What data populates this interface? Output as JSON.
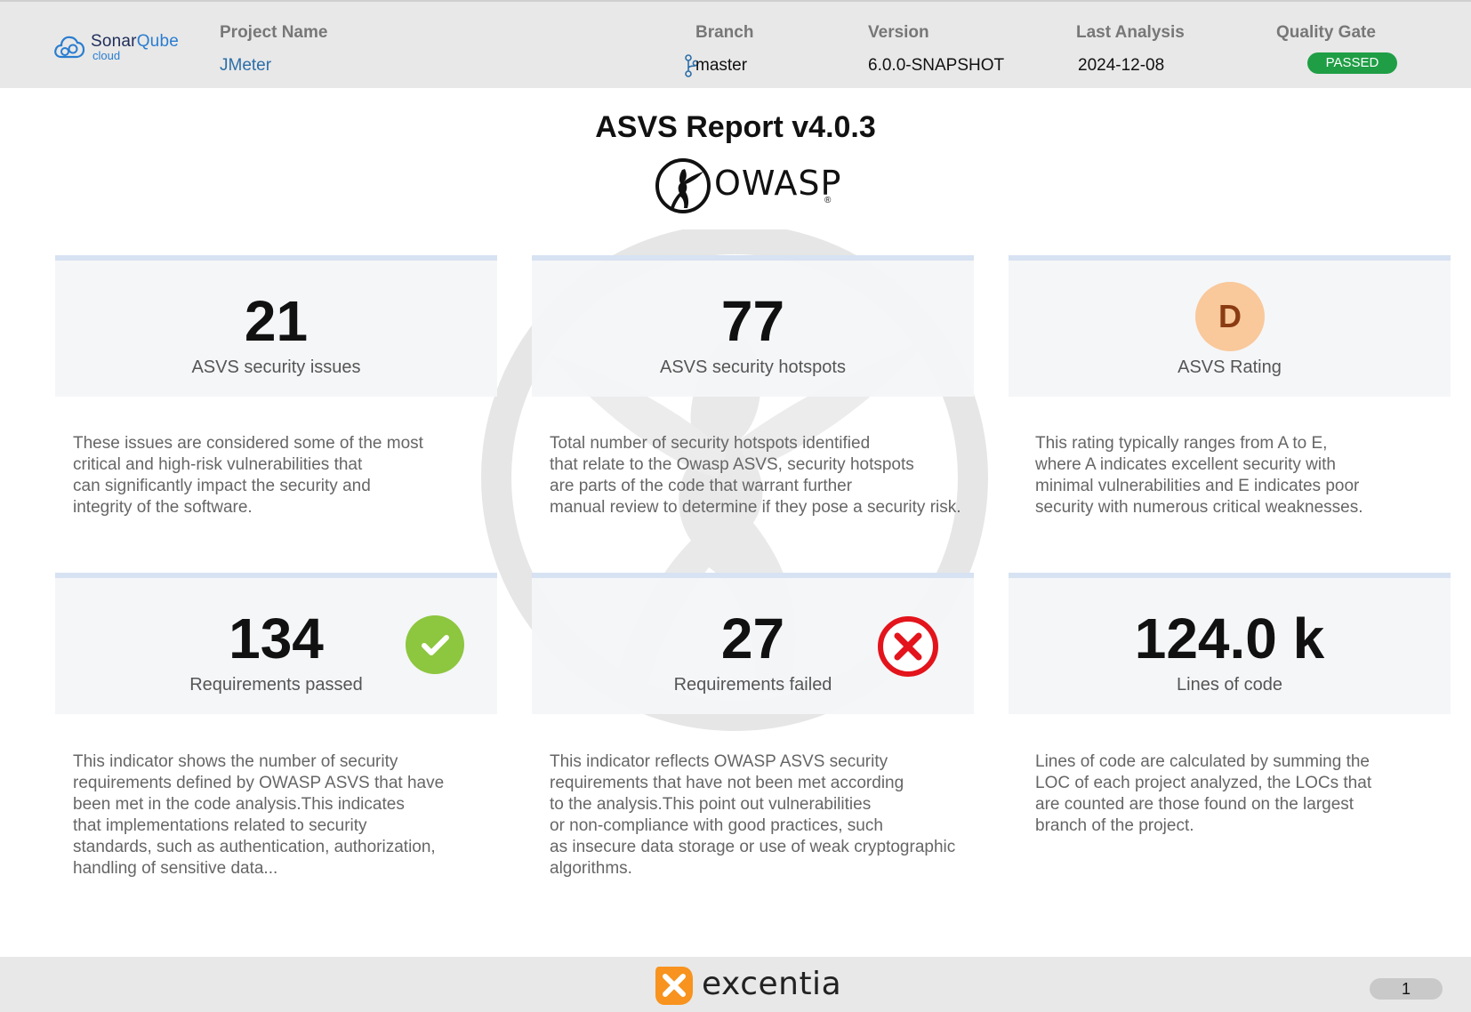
{
  "header": {
    "brand_name_a": "Sonar",
    "brand_name_b": "Qube",
    "brand_sub": "cloud",
    "project_label": "Project Name",
    "project_value": "JMeter",
    "branch_label": "Branch",
    "branch_value": "master",
    "version_label": "Version",
    "version_value": "6.0.0-SNAPSHOT",
    "analysis_label": "Last Analysis",
    "analysis_value": "2024-12-08",
    "gate_label": "Quality Gate",
    "gate_value": "PASSED"
  },
  "title": "ASVS Report v4.0.3",
  "owasp": {
    "text": "OWASP",
    "reg": "®"
  },
  "cards": {
    "issues": {
      "value": "21",
      "caption": "ASVS security issues"
    },
    "hotspots": {
      "value": "77",
      "caption": "ASVS security hotspots"
    },
    "rating": {
      "value": "D",
      "caption": "ASVS Rating"
    },
    "passed": {
      "value": "134",
      "caption": "Requirements passed"
    },
    "failed": {
      "value": "27",
      "caption": "Requirements failed"
    },
    "loc": {
      "value": "124.0 k",
      "caption": "Lines of code"
    }
  },
  "descriptions": {
    "issues": [
      "These issues are considered some of the most",
      "critical and high-risk vulnerabilities that",
      "can significantly impact the security and",
      "integrity of the software."
    ],
    "hotspots": [
      "Total number of security hotspots identified",
      "that relate to the Owasp ASVS, security hotspots",
      "are parts of the code that warrant further",
      "manual review to determine if they pose a security risk."
    ],
    "rating": [
      "This rating typically ranges from A to E,",
      "where A indicates excellent security with",
      "minimal vulnerabilities and E indicates poor",
      "security with numerous critical weaknesses."
    ],
    "passed": [
      "This indicator shows the number of security",
      "requirements defined by OWASP ASVS that have",
      "been met in the code analysis.This indicates",
      "that implementations related to security",
      "standards, such as authentication, authorization,",
      "handling of sensitive data..."
    ],
    "failed": [
      "This indicator reflects OWASP ASVS security",
      "requirements that have not been met according",
      "to the analysis.This point out vulnerabilities",
      "or non-compliance with good practices, such",
      "as insecure data storage or use of weak cryptographic",
      "algorithms."
    ],
    "loc": [
      "Lines of code are calculated by summing the",
      "LOC of each project analyzed, the LOCs that",
      "are counted are those found on the largest",
      "branch of the project."
    ]
  },
  "footer": {
    "brand": "excentia",
    "page": "1"
  },
  "icons": {
    "brand": "cloud-icon",
    "branch": "git-branch-icon",
    "passed": "check-circle-icon",
    "failed": "x-circle-icon"
  },
  "colors": {
    "gate_passed": "#1f9e45",
    "rating_bg": "#f9c89b",
    "rating_text": "#8a3b12",
    "check": "#8dc63f",
    "fail": "#e3141c",
    "card_accent": "#d7e2f2",
    "excentia_orange": "#f7931e"
  }
}
